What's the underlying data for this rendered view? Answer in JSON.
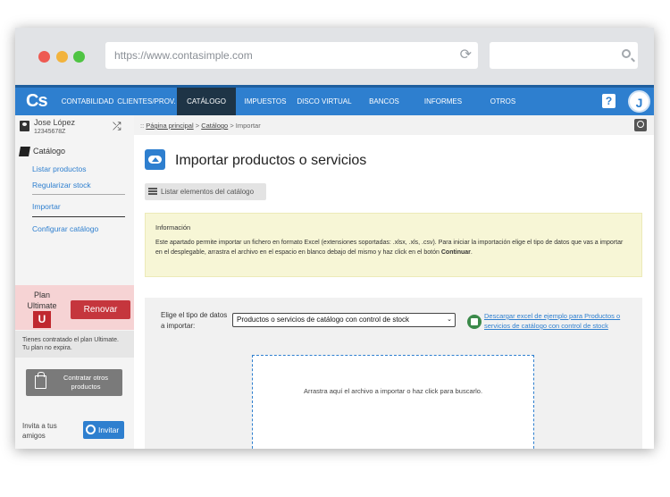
{
  "browser": {
    "url": "https://www.contasimple.com",
    "controls": {
      "close_color": "#ee5a52",
      "minimize_color": "#f2b33d",
      "maximize_color": "#4fc443"
    }
  },
  "topnav": {
    "logo": "Cs",
    "items": [
      {
        "label": "CONTABILIDAD",
        "active": false
      },
      {
        "label": "CLIENTES/PROV.",
        "active": false
      },
      {
        "label": "CATÁLOGO",
        "active": true
      },
      {
        "label": "IMPUESTOS",
        "active": false
      },
      {
        "label": "DISCO VIRTUAL",
        "active": false
      },
      {
        "label": "BANCOS",
        "active": false
      },
      {
        "label": "INFORMES",
        "active": false
      },
      {
        "label": "OTROS",
        "active": false
      }
    ],
    "help_label": "?",
    "avatar_initial": "J",
    "accent_color": "#2e7fcf"
  },
  "sidebar": {
    "user_name": "Jose López",
    "user_id": "12345678Z",
    "section_title": "Catálogo",
    "links": [
      "Listar productos",
      "Regularizar stock",
      "Importar",
      "Configurar catálogo"
    ],
    "plan_label": "Plan Ultimate",
    "plan_badge": "U",
    "renew_label": "Renovar",
    "plan_note": "Tienes contratado el plan Ultimate. Tu plan no expira.",
    "contract_label": "Contratar otros productos",
    "invite_text": "Invita a tus amigos",
    "invite_label": "Invitar"
  },
  "main": {
    "breadcrumb": {
      "prefix": ":: ",
      "home": "Página principal",
      "sep1": " > ",
      "section": "Catálogo",
      "sep2": " > ",
      "current": "Importar"
    },
    "title": "Importar productos o servicios",
    "list_button": "Listar elementos del catálogo",
    "info": {
      "title": "Información",
      "text": "Este apartado permite importar un fichero en formato Excel (extensiones soportadas: .xlsx, .xls, .csv). Para iniciar la importación elige el tipo de datos que vas a importar en el desplegable, arrastra el archivo en el espacio en blanco debajo del mismo y haz click en el botón ",
      "bold": "Continuar",
      "end": "."
    },
    "import": {
      "type_label": "Elige el tipo de datos a importar:",
      "selected_type": "Productos o servicios de catálogo con control de stock",
      "excel_link": "Descargar excel de ejemplo para Productos o servicios de catálogo con control de stock",
      "dropzone_text": "Arrastra aquí el archivo a importar o haz click para buscarlo."
    }
  }
}
